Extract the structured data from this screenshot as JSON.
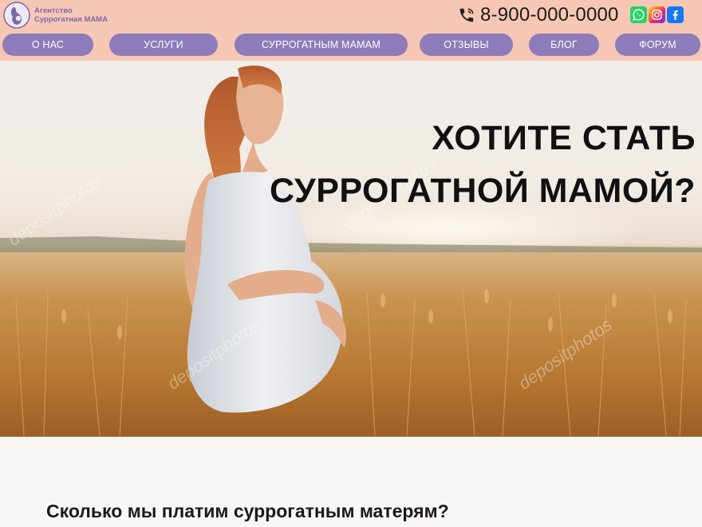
{
  "header": {
    "logo": {
      "line1": "Агентство",
      "line2": "Суррогатная МАМА"
    },
    "phone": "8-900-000-0000",
    "social": [
      {
        "icon": "whatsapp-icon",
        "color": "#25d366"
      },
      {
        "icon": "instagram-icon",
        "color": "#d62976"
      },
      {
        "icon": "facebook-icon",
        "color": "#1877f2"
      }
    ]
  },
  "nav": {
    "items": [
      {
        "label": "О НАС"
      },
      {
        "label": "УСЛУГИ"
      },
      {
        "label": "СУРРОГАТНЫМ МАМАМ"
      },
      {
        "label": "ОТЗЫВЫ"
      },
      {
        "label": "БЛОГ"
      },
      {
        "label": "ФОРУМ"
      }
    ]
  },
  "hero": {
    "title_line1": "ХОТИТЕ СТАТЬ",
    "title_line2": "СУРРОГАТНОЙ МАМОЙ?"
  },
  "section": {
    "heading": "Сколько мы платим суррогатным матерям?"
  },
  "colors": {
    "header_bg": "#f6c7b4",
    "nav_button": "#8d7bba",
    "nav_text": "#ffffff",
    "brand_text": "#7a6aa8"
  }
}
